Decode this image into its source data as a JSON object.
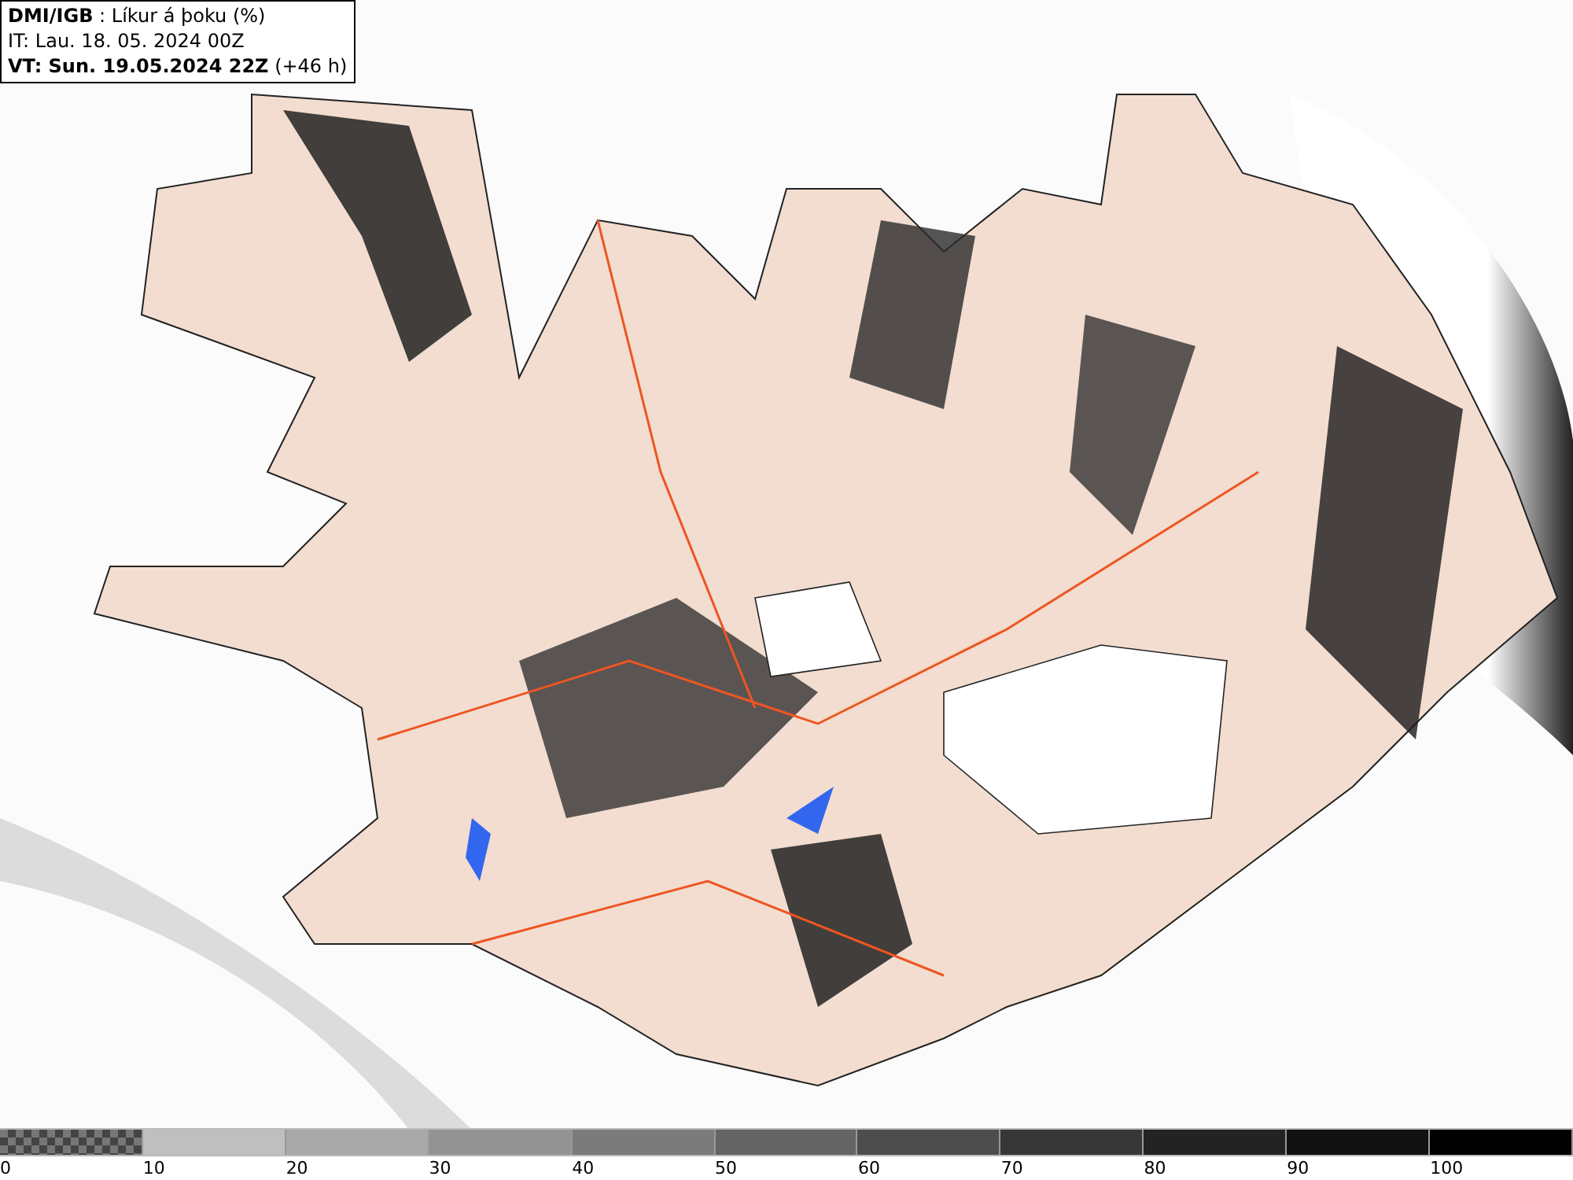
{
  "header": {
    "title": "**DMI/IGB** : Líkur á þoku (%)",
    "issued": "IT: Lau. 18. 05. 2024 00Z",
    "valid": "**VT: Sun. 19.05.2024 22Z** (+46 h)"
  },
  "legend": {
    "items": [
      {
        "kind": "checker",
        "color": "#777777",
        "label": "0"
      },
      {
        "kind": "solid",
        "color": "#bfbfbf",
        "label": "10"
      },
      {
        "kind": "solid",
        "color": "#a9a9a9",
        "label": "20"
      },
      {
        "kind": "solid",
        "color": "#939393",
        "label": "30"
      },
      {
        "kind": "solid",
        "color": "#7b7b7b",
        "label": "40"
      },
      {
        "kind": "solid",
        "color": "#646464",
        "label": "50"
      },
      {
        "kind": "solid",
        "color": "#4d4d4d",
        "label": "60"
      },
      {
        "kind": "solid",
        "color": "#373737",
        "label": "70"
      },
      {
        "kind": "solid",
        "color": "#232323",
        "label": "80"
      },
      {
        "kind": "solid",
        "color": "#121212",
        "label": "90"
      },
      {
        "kind": "solid",
        "color": "#000000",
        "label": "100"
      }
    ]
  }
}
